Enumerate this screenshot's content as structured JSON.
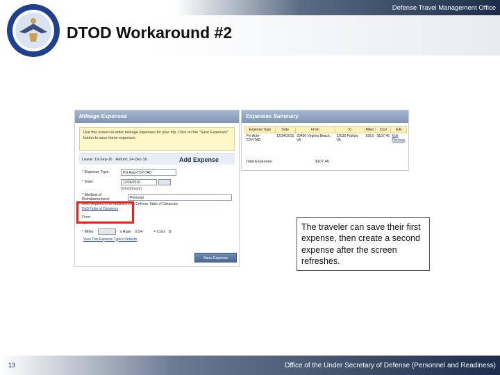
{
  "header": {
    "org_name": "Defense Travel Management Office",
    "title": "DTOD Workaround #2"
  },
  "mileage_panel": {
    "heading": "Mileage Expenses",
    "notice": "Use this screen to enter mileage expenses for your trip. Click on the \"Save Expenses\" button to save these expenses.",
    "leave": "Leave: 19-Sep-16",
    "return": "Return: 24-Dec-16",
    "add_expense": "Add Expense",
    "expense_type_label": "* Expense Type:",
    "expense_type_value": "Pvt Auto-TDY/TAD",
    "date_label": "* Date:",
    "date_value": "12/24/2016",
    "date_hint": "(mm/dd/yyyy)",
    "reimbursement_label": "* Method of Reimbursement:",
    "reimbursement_value": "Personal",
    "dod_table_note": "Miles required to be obtained from Defense Table of Distances",
    "dod_table_link": "DoD Table of Distances",
    "from_label": "From:",
    "to_label": "To:",
    "miles_label": "* Miles",
    "rate_label": "x  Rate",
    "rate_value": "0.54",
    "cost_label": "=  Cost",
    "cost_value": "$",
    "view_link": "View This Expense Type's Defaults",
    "save_button": "Save Expense"
  },
  "summary_panel": {
    "heading": "Expenses Summary",
    "columns": [
      "Expense Type",
      "Date",
      "From",
      "To",
      "Miles",
      "Cost",
      "E/R"
    ],
    "row": {
      "type": "Pvt Auto-TDY/TAD",
      "date": "12/24/2016",
      "from": "23456 Virginia Beach, VA",
      "to": "22030 Fairfax, VA",
      "miles": "199.0",
      "cost": "$107.46",
      "edit": "Edit",
      "remove": "Remove"
    },
    "total_label": "Total Expenses:",
    "total_value": "$107.46"
  },
  "callout": {
    "text": "The traveler can save their first expense, then create a second expense after the screen refreshes."
  },
  "footer": {
    "page_number": "13",
    "text": "Office of the Under Secretary of Defense (Personnel and Readiness)"
  }
}
